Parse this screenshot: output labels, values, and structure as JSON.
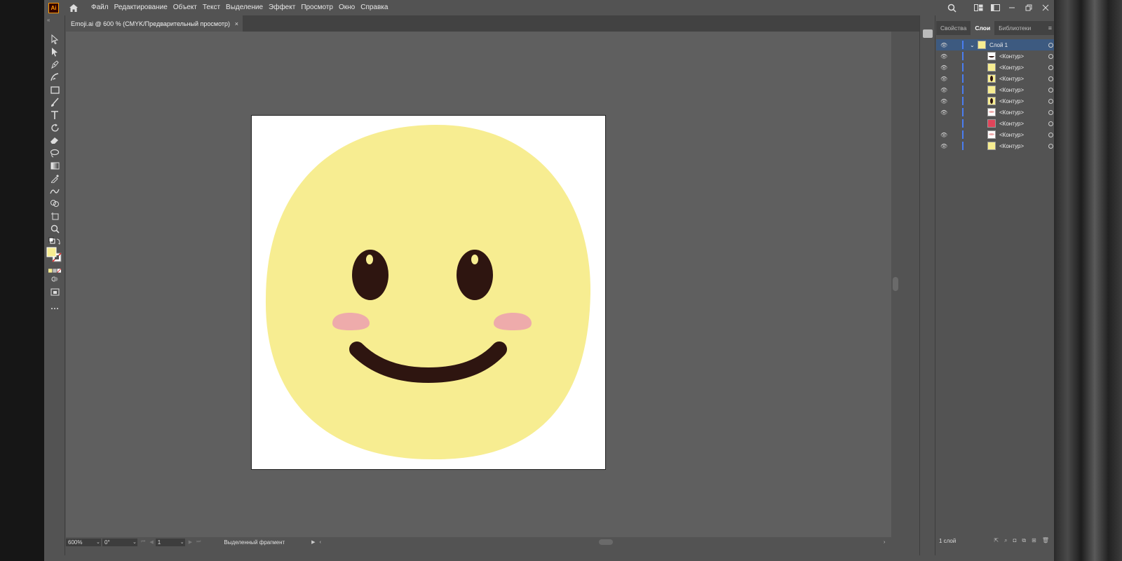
{
  "app": {
    "logo": "Ai",
    "menu": [
      "Файл",
      "Редактирование",
      "Объект",
      "Текст",
      "Выделение",
      "Эффект",
      "Просмотр",
      "Окно",
      "Справка"
    ]
  },
  "document": {
    "tab_title": "Emoji.ai @ 600 % (CMYK/Предварительный просмотр)",
    "tab_close": "×"
  },
  "status": {
    "zoom": "600%",
    "rotation": "0°",
    "artboard": "1",
    "selection_label": "Выделенный фрагмент"
  },
  "panel": {
    "tabs": [
      "Свойства",
      "Слои",
      "Библиотеки"
    ],
    "active_tab": "Слои",
    "layer_name": "Слой 1",
    "sublayers": [
      {
        "name": "<Контур>",
        "visible": true,
        "thumb": "mouth"
      },
      {
        "name": "<Контур>",
        "visible": true,
        "thumb": "yellow"
      },
      {
        "name": "<Контур>",
        "visible": true,
        "thumb": "eye"
      },
      {
        "name": "<Контур>",
        "visible": true,
        "thumb": "yellow"
      },
      {
        "name": "<Контур>",
        "visible": true,
        "thumb": "eye"
      },
      {
        "name": "<Контур>",
        "visible": true,
        "thumb": "blush"
      },
      {
        "name": "<Контур>",
        "visible": false,
        "thumb": "red"
      },
      {
        "name": "<Контур>",
        "visible": true,
        "thumb": "blush"
      },
      {
        "name": "<Контур>",
        "visible": true,
        "thumb": "yellow"
      }
    ],
    "footer_label": "1 слой"
  },
  "colors": {
    "face": "#f7ed91",
    "eye": "#2e1510",
    "eye_highlight": "#f7ed91",
    "blush": "#eeabab",
    "mouth": "#2e1510",
    "layer_accent": "#4a7df0",
    "fill_swatch": "#f7ed91"
  }
}
